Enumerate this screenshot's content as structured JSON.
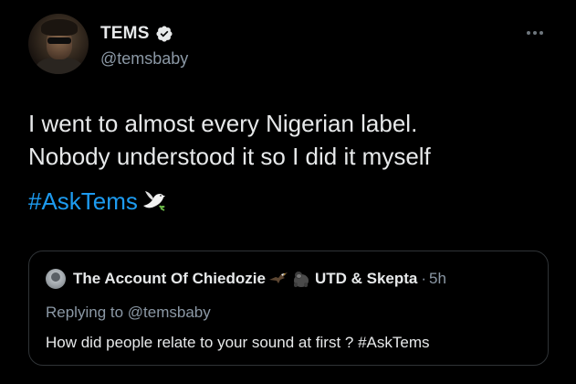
{
  "tweet": {
    "display_name": "TEMS",
    "handle": "@temsbaby",
    "verified": true,
    "text_line1": "I went to almost every Nigerian label.",
    "text_line2": "Nobody understood it so I did it myself",
    "hashtag": "#AskTems",
    "hashtag_emoji": "dove-icon",
    "more_icon": "more-icon"
  },
  "quoted": {
    "display_name": "The Account Of Chiedozie",
    "emojis": [
      "eagle-icon",
      "gorilla-icon"
    ],
    "display_name_suffix": "UTD & Skepta",
    "separator": "·",
    "time": "5h",
    "replying_label": "Replying to",
    "replying_handle": "@temsbaby",
    "text": "How did people relate to your sound at first ? #AskTems"
  },
  "colors": {
    "background": "#000000",
    "primary_text": "#e7e9ea",
    "secondary_text": "#8b98a5",
    "link": "#1d9bf0",
    "border": "#2f3336",
    "verified_badge": "#e7e9ea"
  }
}
